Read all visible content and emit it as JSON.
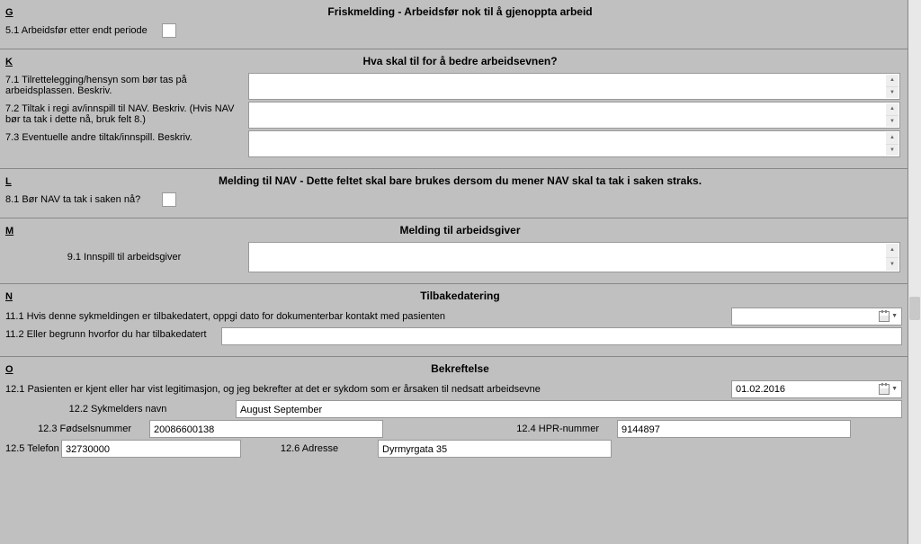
{
  "sections": {
    "G": {
      "letter": "G",
      "title": "Friskmelding - Arbeidsfør nok til å gjenoppta arbeid",
      "f51_label": "5.1 Arbeidsfør etter endt periode"
    },
    "K": {
      "letter": "K",
      "title": "Hva skal til for å bedre arbeidsevnen?",
      "f71_label": "7.1 Tilrettelegging/hensyn som bør tas på arbeidsplassen. Beskriv.",
      "f72_label": "7.2 Tiltak i regi av/innspill til NAV. Beskriv. (Hvis NAV bør ta tak i dette nå, bruk felt 8.)",
      "f73_label": "7.3 Eventuelle andre tiltak/innspill. Beskriv."
    },
    "L": {
      "letter": "L",
      "title": "Melding til NAV - Dette feltet skal bare brukes dersom du mener NAV skal ta tak i saken straks.",
      "f81_label": "8.1 Bør NAV ta tak i saken nå?"
    },
    "M": {
      "letter": "M",
      "title": "Melding til arbeidsgiver",
      "f91_label": "9.1 Innspill til arbeidsgiver"
    },
    "N": {
      "letter": "N",
      "title": "Tilbakedatering",
      "f111_label": "11.1 Hvis denne sykmeldingen er tilbakedatert, oppgi dato for dokumenterbar kontakt med pasienten",
      "f112_label": "11.2 Eller begrunn hvorfor du har tilbakedatert"
    },
    "O": {
      "letter": "O",
      "title": "Bekreftelse",
      "f121_label": "12.1 Pasienten er kjent eller har vist legitimasjon, og jeg bekrefter at det er sykdom som er årsaken til nedsatt arbeidsevne",
      "f121_value": "01.02.2016",
      "f122_label": "12.2 Sykmelders navn",
      "f122_value": "August September",
      "f123_label": "12.3 Fødselsnummer",
      "f123_value": "20086600138",
      "f124_label": "12.4 HPR-nummer",
      "f124_value": "9144897",
      "f125_label": "12.5 Telefon",
      "f125_value": "32730000",
      "f126_label": "12.6 Adresse",
      "f126_value": "Dyrmyrgata 35"
    }
  },
  "textarea_values": {
    "f71": "",
    "f72": "",
    "f73": "",
    "f91": "",
    "f112": ""
  },
  "checkbox_values": {
    "f51": false,
    "f81": false
  },
  "date_values": {
    "f111": ""
  }
}
